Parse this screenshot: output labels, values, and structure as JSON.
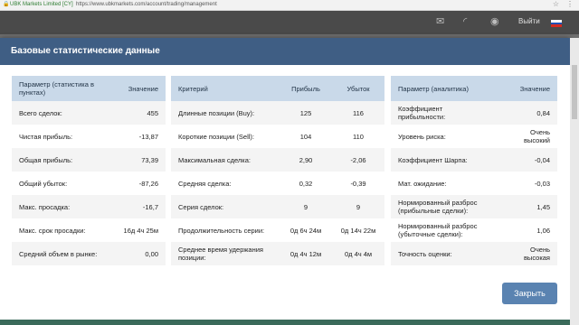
{
  "browser": {
    "site_badge": "UBK Markets Limited [CY]",
    "url": "https://www.ubkmarkets.com/account/trading/management"
  },
  "topbar": {
    "icons": [
      "envelope-icon",
      "signal-icon",
      "rss-icon"
    ],
    "logout_label": "Выйти",
    "flag_colors": [
      "#ffffff",
      "#1f4fb5",
      "#d52b1e"
    ]
  },
  "modal": {
    "title": "Базовые статистические данные",
    "close_label": "Закрыть"
  },
  "panel1": {
    "headers": [
      "Параметр (статистика в пунктах)",
      "Значение"
    ],
    "rows": [
      {
        "label": "Всего сделок:",
        "value": "455"
      },
      {
        "label": "Чистая прибыль:",
        "value": "-13,87"
      },
      {
        "label": "Общая прибыль:",
        "value": "73,39"
      },
      {
        "label": "Общий убыток:",
        "value": "-87,26"
      },
      {
        "label": "Макс. просадка:",
        "value": "-16,7"
      },
      {
        "label": "Макс. срок просадки:",
        "value": "16д 4ч 25м"
      },
      {
        "label": "Средний объем в рынке:",
        "value": "0,00"
      }
    ]
  },
  "panel2": {
    "headers": [
      "Критерий",
      "Прибыль",
      "Убыток"
    ],
    "rows": [
      {
        "label": "Длинные позиции (Buy):",
        "profit": "125",
        "loss": "116"
      },
      {
        "label": "Короткие позиции (Sell):",
        "profit": "104",
        "loss": "110"
      },
      {
        "label": "Максимальная сделка:",
        "profit": "2,90",
        "loss": "-2,06"
      },
      {
        "label": "Средняя сделка:",
        "profit": "0,32",
        "loss": "-0,39"
      },
      {
        "label": "Серия сделок:",
        "profit": "9",
        "loss": "9"
      },
      {
        "label": "Продолжительность серии:",
        "profit": "0д 6ч 24м",
        "loss": "0д 14ч 22м"
      },
      {
        "label": "Среднее время удержания позиции:",
        "profit": "0д 4ч 12м",
        "loss": "0д 4ч 4м"
      }
    ]
  },
  "panel3": {
    "headers": [
      "Параметр (аналитика)",
      "Значение"
    ],
    "rows": [
      {
        "label": "Коэффициент прибыльности:",
        "value": "0,84"
      },
      {
        "label": "Уровень риска:",
        "value": "Очень высокий"
      },
      {
        "label": "Коэффициент Шарпа:",
        "value": "-0,04"
      },
      {
        "label": "Мат. ожидание:",
        "value": "-0,03"
      },
      {
        "label": "Нормированный разброс (прибыльные сделки):",
        "value": "1,45"
      },
      {
        "label": "Нормированный разброс (убыточные сделки):",
        "value": "1,06"
      },
      {
        "label": "Точность оценки:",
        "value": "Очень высокая"
      }
    ]
  }
}
